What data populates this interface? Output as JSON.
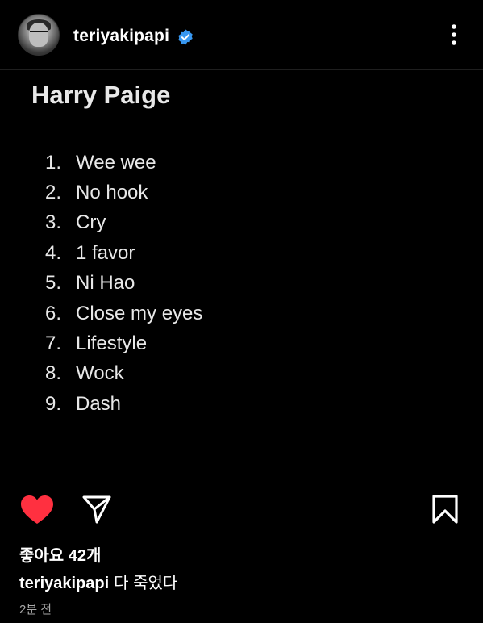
{
  "header": {
    "username": "teriyakipapi",
    "avatar_icon": "profile-photo",
    "verified_icon": "verified-badge-icon",
    "more_icon": "more-vertical-icon"
  },
  "post": {
    "title": "Harry Paige",
    "tracks": [
      {
        "num": "1.",
        "name": "Wee wee"
      },
      {
        "num": "2.",
        "name": "No hook"
      },
      {
        "num": "3.",
        "name": "Cry"
      },
      {
        "num": "4.",
        "name": "1 favor"
      },
      {
        "num": "5.",
        "name": "Ni Hao"
      },
      {
        "num": "6.",
        "name": "Close my eyes"
      },
      {
        "num": "7.",
        "name": "Lifestyle"
      },
      {
        "num": "8.",
        "name": "Wock"
      },
      {
        "num": "9.",
        "name": "Dash"
      }
    ]
  },
  "actions": {
    "like_icon": "heart-filled-icon",
    "share_icon": "send-icon",
    "save_icon": "bookmark-icon"
  },
  "likes": "좋아요 42개",
  "caption": {
    "username": "teriyakipapi",
    "text": "다 죽었다"
  },
  "timestamp": "2분 전",
  "colors": {
    "background": "#000000",
    "text": "#ffffff",
    "like_red": "#ff3040",
    "verified_blue": "#3897f0",
    "muted": "#a8a8a8"
  }
}
